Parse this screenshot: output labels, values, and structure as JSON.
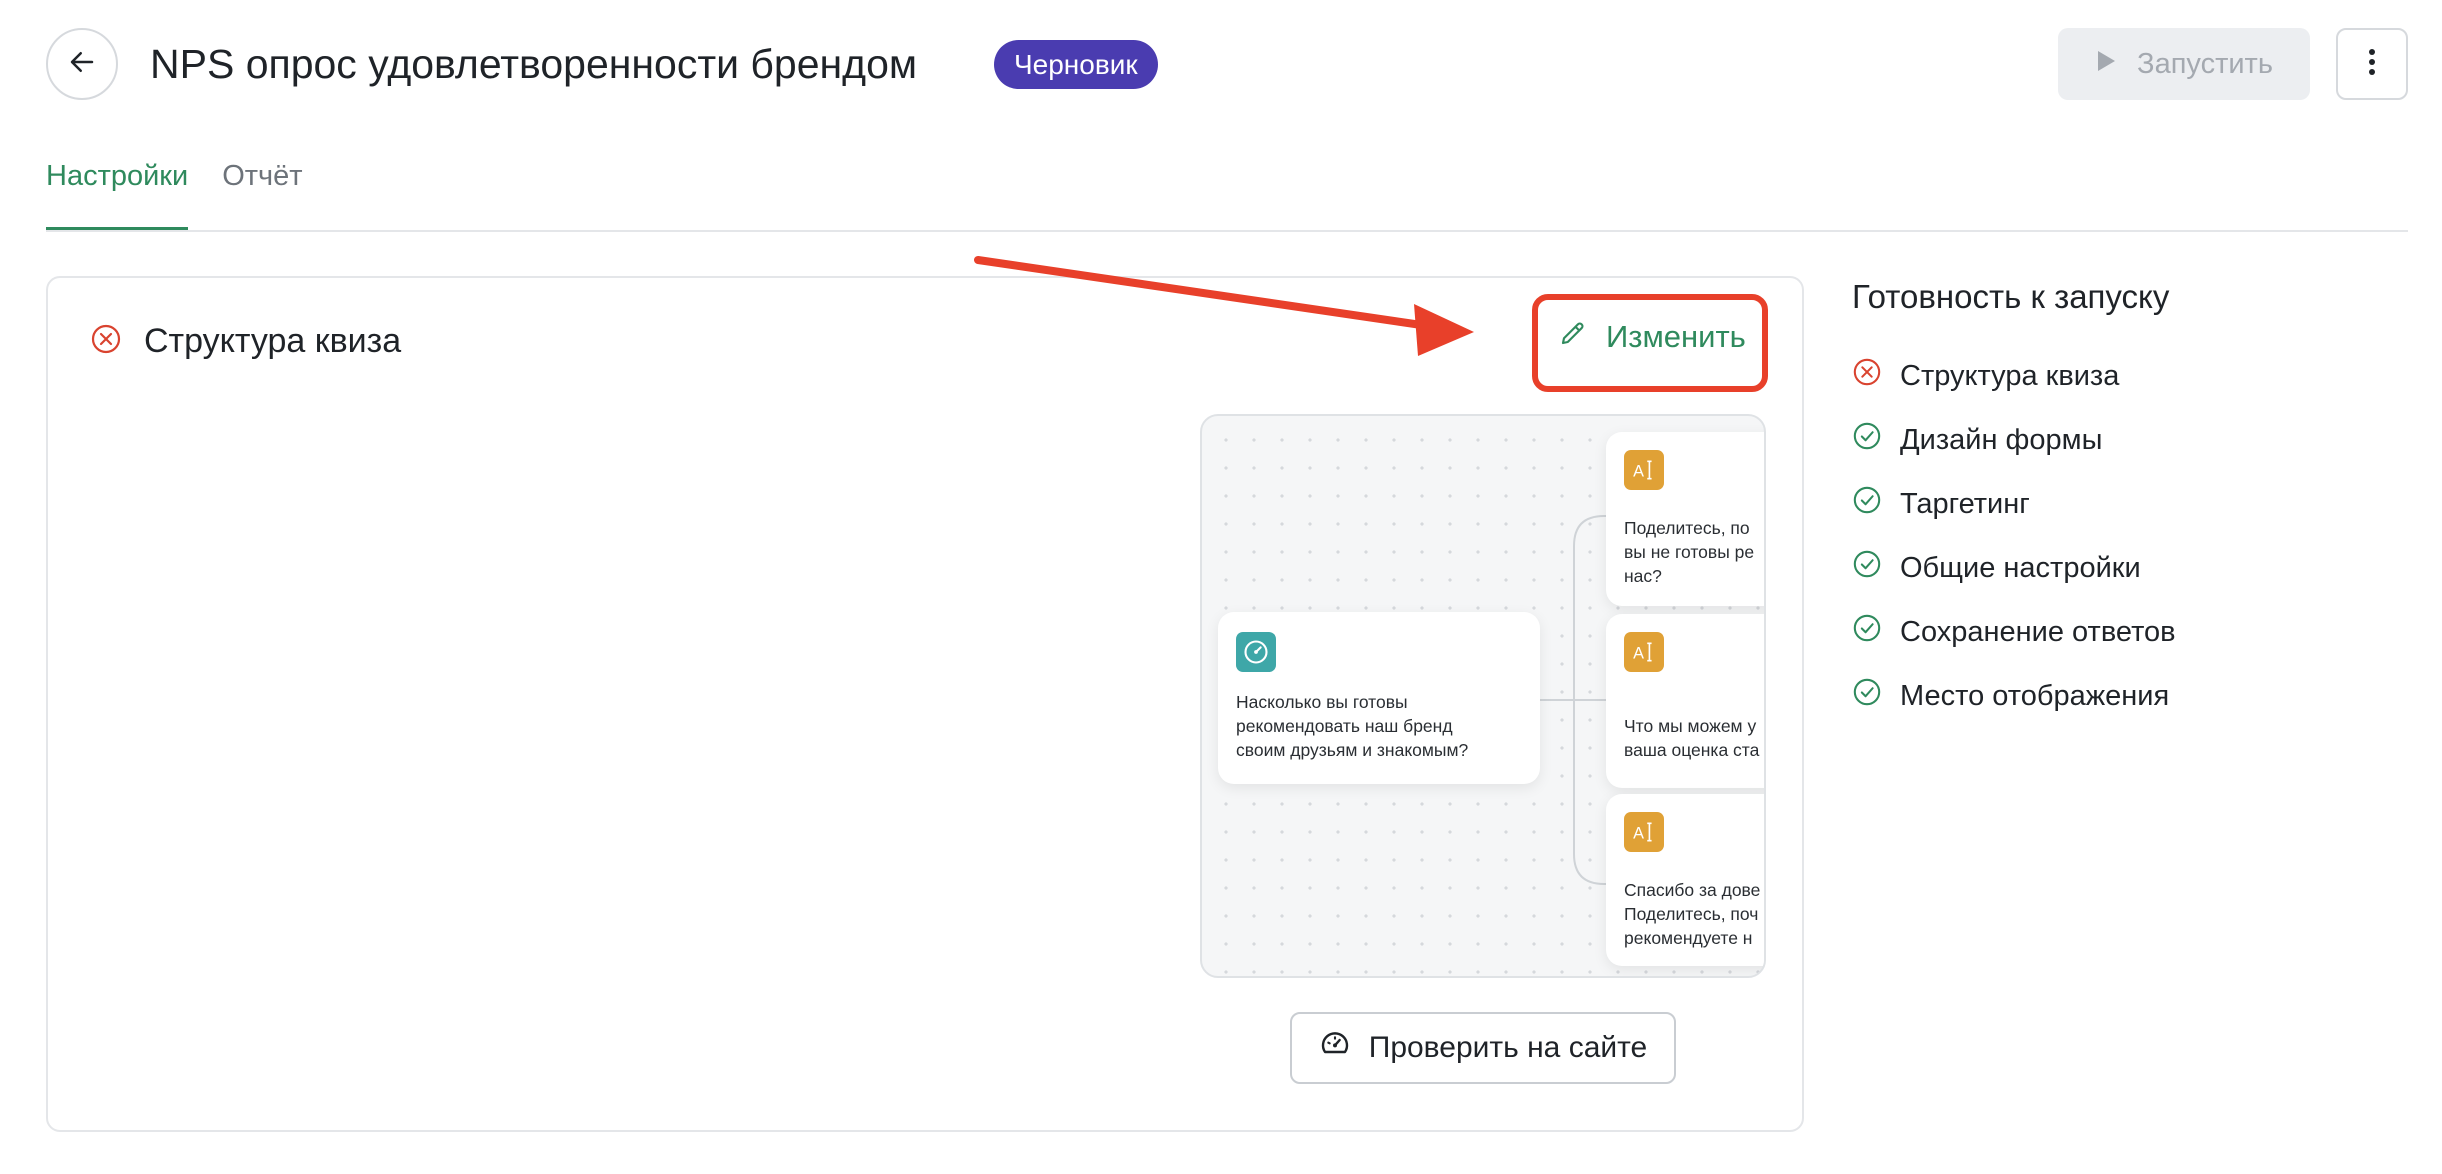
{
  "header": {
    "back_icon": "arrow-left-icon",
    "title": "NPS опрос удовлетворенности брендом",
    "status_badge": "Черновик",
    "launch_label": "Запустить",
    "launch_icon": "play-icon",
    "more_icon": "kebab-menu-icon"
  },
  "tabs": [
    {
      "label": "Настройки",
      "active": true
    },
    {
      "label": "Отчёт",
      "active": false
    }
  ],
  "quiz_structure": {
    "status_icon": "error-circle-icon",
    "title": "Структура квиза",
    "edit_label": "Изменить",
    "edit_icon": "pencil-icon",
    "check_label": "Проверить на сайте",
    "check_icon": "speedometer-icon",
    "preview": {
      "root_node": {
        "icon": "gauge-icon",
        "text_lines": [
          "Насколько вы готовы",
          "рекомендовать наш бренд",
          "своим друзьям и знакомым?"
        ]
      },
      "branch_nodes": [
        {
          "icon": "text-input-icon",
          "text_lines": [
            "Поделитесь, по",
            "вы не готовы ре",
            "нас?"
          ]
        },
        {
          "icon": "text-input-icon",
          "text_lines": [
            "Что мы можем у",
            "ваша оценка ста"
          ]
        },
        {
          "icon": "text-input-icon",
          "text_lines": [
            "Спасибо за дове",
            "Поделитесь, поч",
            "рекомендуете н"
          ]
        }
      ]
    }
  },
  "readiness": {
    "title": "Готовность к запуску",
    "items": [
      {
        "label": "Структура квиза",
        "status": "error"
      },
      {
        "label": "Дизайн формы",
        "status": "ok"
      },
      {
        "label": "Таргетинг",
        "status": "ok"
      },
      {
        "label": "Общие настройки",
        "status": "ok"
      },
      {
        "label": "Сохранение ответов",
        "status": "ok"
      },
      {
        "label": "Место отображения",
        "status": "ok"
      }
    ]
  },
  "colors": {
    "accent_green": "#2f8a5d",
    "badge_purple": "#4a3cb0",
    "error_red": "#d9432f",
    "annotation_red": "#e8402a",
    "node_teal": "#3ea7a8",
    "node_amber": "#e0a136"
  }
}
